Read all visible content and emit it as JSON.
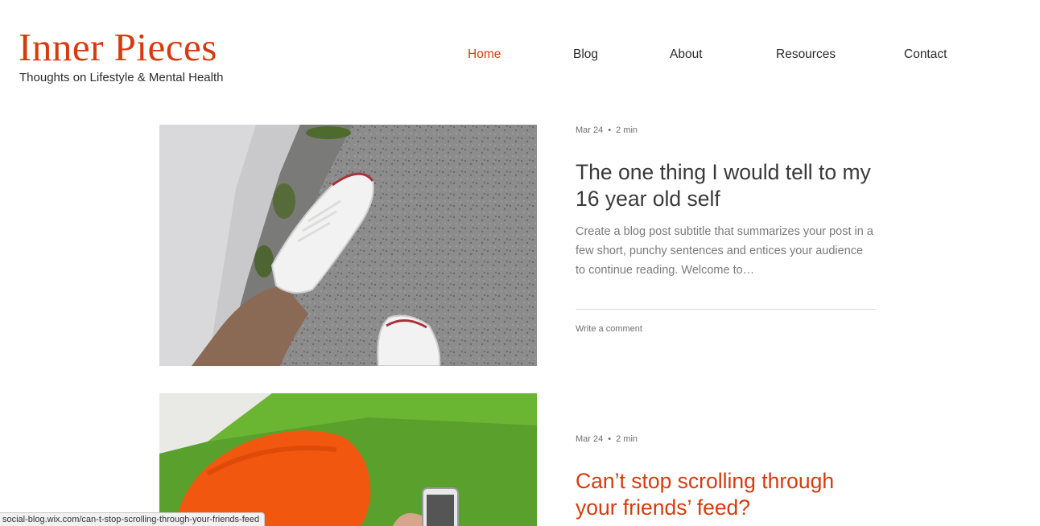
{
  "site": {
    "title": "Inner Pieces",
    "tagline": "Thoughts on Lifestyle & Mental Health",
    "accent_color": "#d83a0f"
  },
  "nav": {
    "items": [
      {
        "label": "Home",
        "active": true
      },
      {
        "label": "Blog",
        "active": false
      },
      {
        "label": "About",
        "active": false
      },
      {
        "label": "Resources",
        "active": false
      },
      {
        "label": "Contact",
        "active": false
      }
    ]
  },
  "posts": [
    {
      "date": "Mar 24",
      "read_time": "2 min",
      "title": "The one thing I would tell to my 16 year old self",
      "excerpt": "Create a blog post subtitle that summarizes your post in a few short, punchy sentences and entices your audience to continue reading. Welcome to…",
      "comment_link": "Write a comment",
      "image_subject": "white-sneakers-on-pavement-photo"
    },
    {
      "date": "Mar 24",
      "read_time": "2 min",
      "title": "Can’t stop scrolling through your friends’ feed?",
      "image_subject": "orange-beanie-phone-on-grass-photo"
    }
  ],
  "status_bar": {
    "url": "social-blog.wix.com/can-t-stop-scrolling-through-your-friends-feed"
  }
}
